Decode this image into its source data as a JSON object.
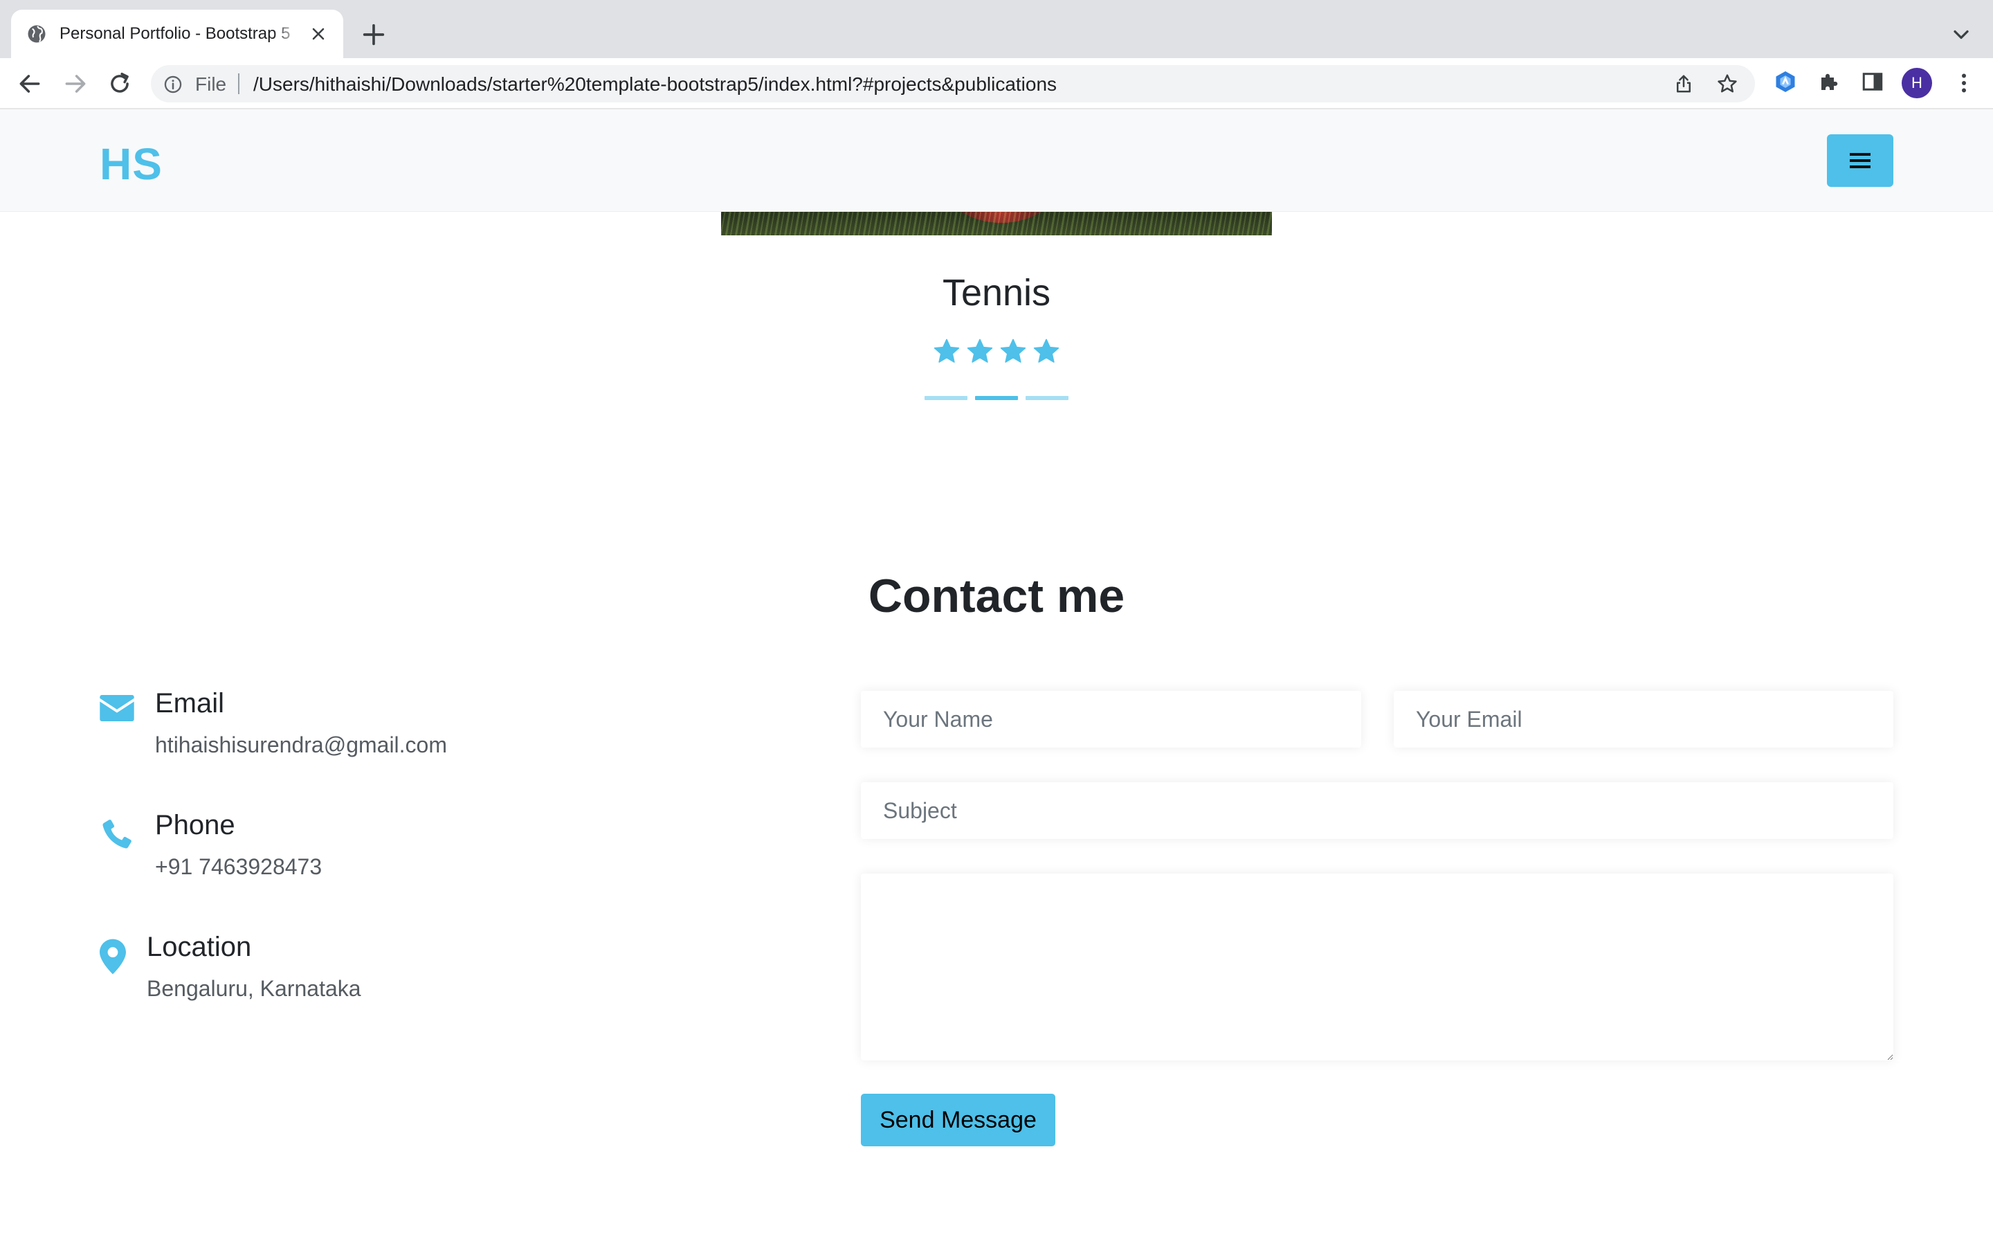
{
  "browser": {
    "tab_title": "Personal Portfolio - Bootstrap 5",
    "address_scheme": "File",
    "url": "/Users/hithaishi/Downloads/starter%20template-bootstrap5/index.html?#projects&publications",
    "profile_initial": "H",
    "icons": [
      "globe-icon",
      "close-icon",
      "plus-icon",
      "chevron-down-icon",
      "back-arrow-icon",
      "forward-arrow-icon",
      "reload-icon",
      "info-icon",
      "share-icon",
      "star-icon",
      "extension-icon",
      "puzzle-icon",
      "side-panel-icon",
      "more-vert-icon"
    ]
  },
  "site": {
    "logo": "HS",
    "menu_icon": "hamburger-icon",
    "accent_color": "#4ec0e9"
  },
  "hobbies": {
    "current_title": "Tennis",
    "rating": 4,
    "rating_max": 4,
    "slide_count": 3,
    "active_slide": 2
  },
  "contact": {
    "title": "Contact me",
    "email": {
      "label": "Email",
      "value": "htihaishisurendra@gmail.com",
      "icon": "envelope-icon"
    },
    "phone": {
      "label": "Phone",
      "value": "+91 7463928473",
      "icon": "phone-icon"
    },
    "location": {
      "label": "Location",
      "value": "Bengaluru, Karnataka",
      "icon": "map-pin-icon"
    },
    "form": {
      "name_placeholder": "Your Name",
      "email_placeholder": "Your Email",
      "subject_placeholder": "Subject",
      "message_placeholder": "",
      "submit_label": "Send Message"
    }
  }
}
